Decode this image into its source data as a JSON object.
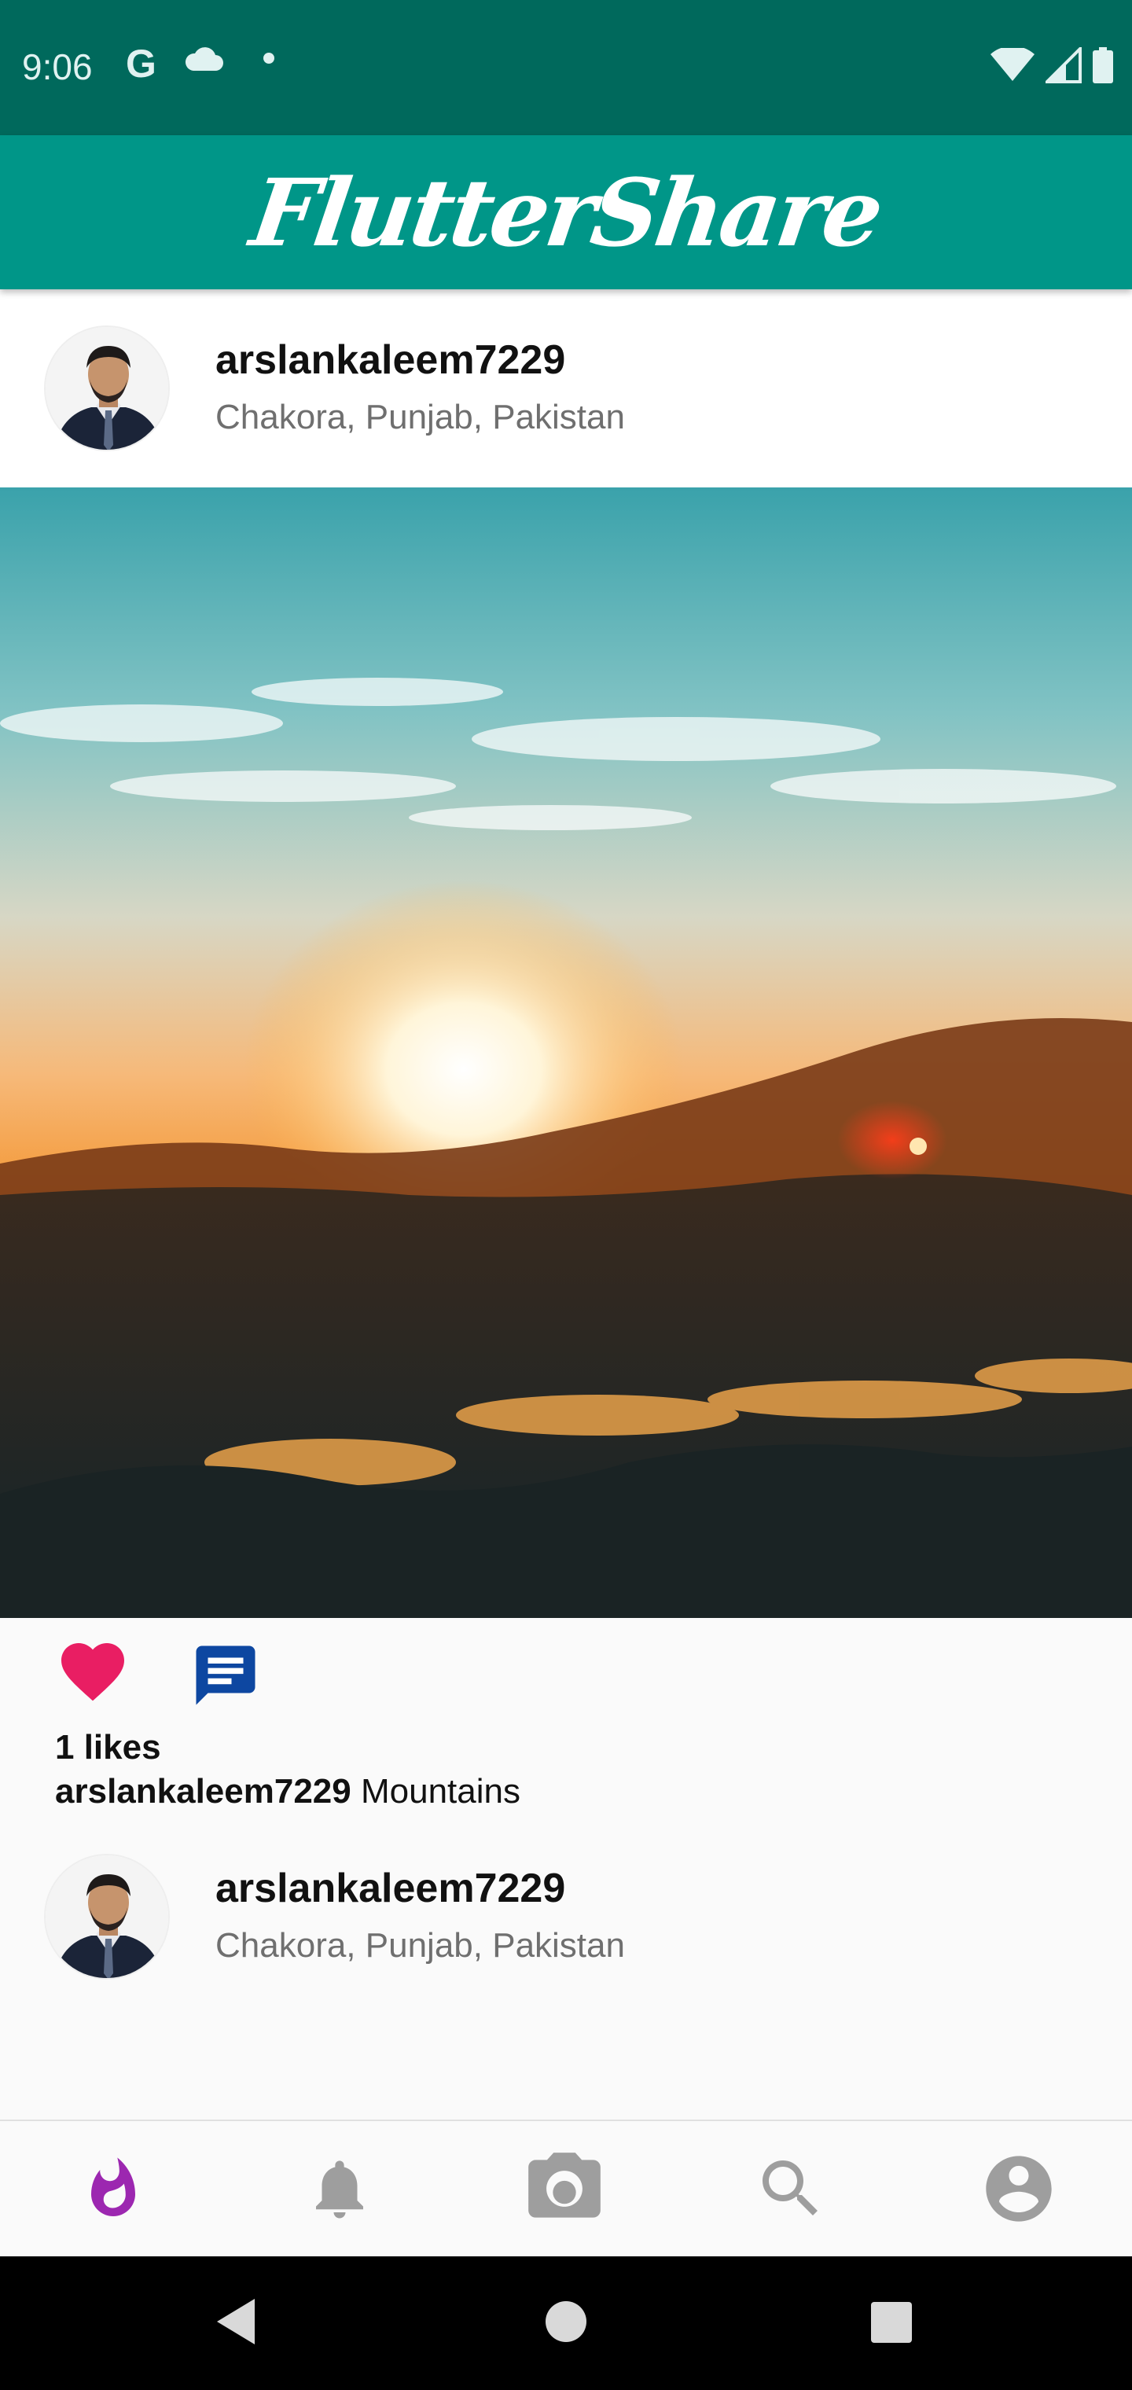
{
  "status_bar": {
    "time": "9:06",
    "google_icon": "G",
    "icons_left": [
      "google-icon",
      "cloud-icon",
      "notification-dot-icon"
    ],
    "icons_right": [
      "wifi-icon",
      "cell-signal-icon",
      "battery-icon"
    ]
  },
  "app_bar": {
    "title": "FlutterShare",
    "color": "#009688",
    "status_color": "#00695c"
  },
  "post": {
    "username": "arslankaleem7229",
    "location": "Chakora, Punjab, Pakistan",
    "image_icon": "sunset-over-mountains-photo",
    "likes_text": "1 likes",
    "caption_user": "arslankaleem7229",
    "caption_text": " Mountains",
    "like_color": "#e91e63",
    "comment_color": "#0d47a1"
  },
  "next_post": {
    "username": "arslankaleem7229",
    "location": "Chakora, Punjab, Pakistan"
  },
  "bottom_nav": {
    "items": [
      {
        "name": "timeline",
        "icon": "whatshot-icon",
        "active": true
      },
      {
        "name": "activity",
        "icon": "notifications-icon",
        "active": false
      },
      {
        "name": "upload",
        "icon": "camera-icon",
        "active": false
      },
      {
        "name": "search",
        "icon": "search-icon",
        "active": false
      },
      {
        "name": "profile",
        "icon": "account-circle-icon",
        "active": false
      }
    ],
    "active_color": "#9c27b0",
    "inactive_color": "#9e9e9e"
  },
  "system_nav": [
    "back-icon",
    "home-icon",
    "recents-icon"
  ]
}
